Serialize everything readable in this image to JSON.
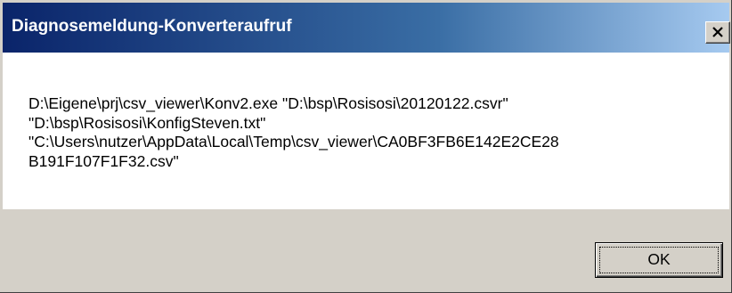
{
  "window": {
    "title": "Diagnosemeldung-Konverteraufruf",
    "close_icon": "close-icon"
  },
  "message": {
    "lines": [
      "D:\\Eigene\\prj\\csv_viewer\\Konv2.exe \"D:\\bsp\\Rosisosi\\20120122.csvr\"",
      "\"D:\\bsp\\Rosisosi\\KonfigSteven.txt\"",
      "\"C:\\Users\\nutzer\\AppData\\Local\\Temp\\csv_viewer\\CA0BF3FB6E142E2CE28",
      "B191F107F1F32.csv\""
    ]
  },
  "buttons": {
    "ok_label": "OK"
  },
  "colors": {
    "titlebar_start": "#0a246a",
    "titlebar_end": "#a6caf0",
    "face": "#d4d0c8",
    "content_bg": "#ffffff"
  }
}
